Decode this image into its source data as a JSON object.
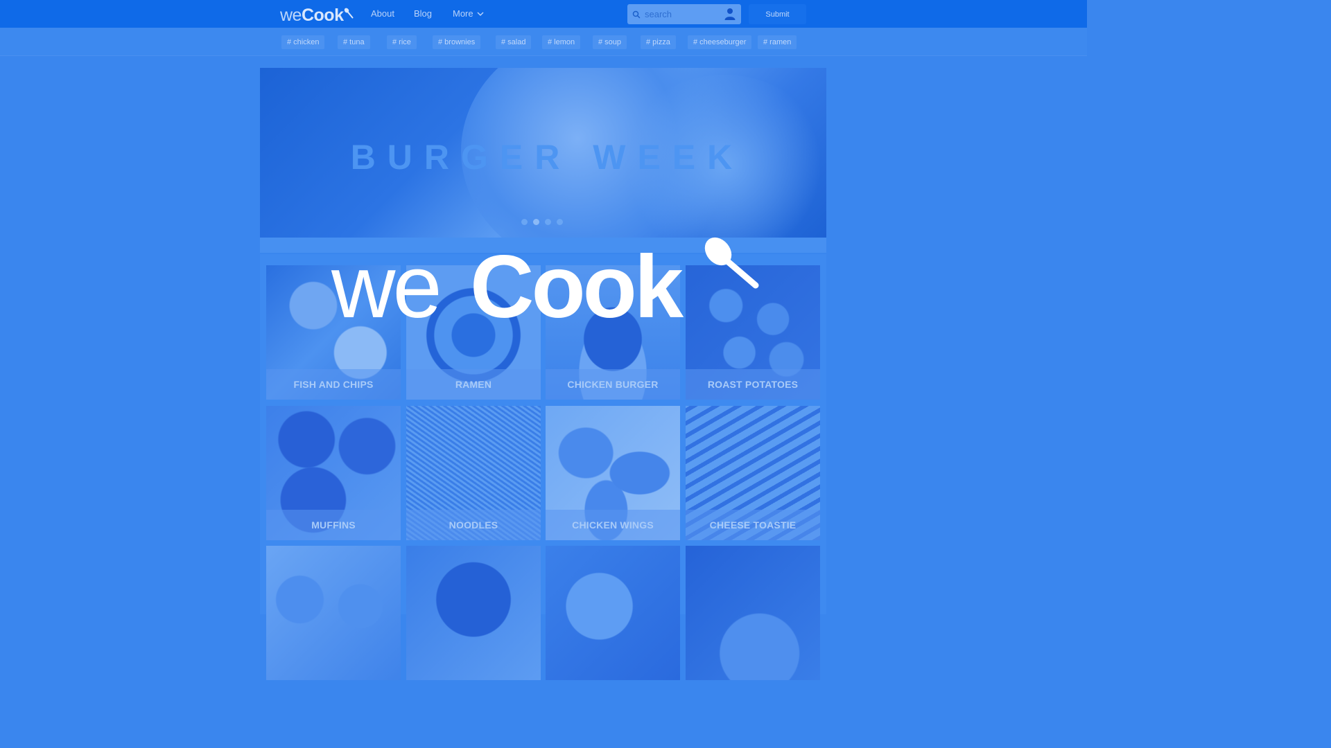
{
  "header": {
    "logo": {
      "we": "we",
      "cook": "Cook"
    },
    "nav": [
      {
        "label": "About"
      },
      {
        "label": "Blog"
      },
      {
        "label": "More"
      }
    ],
    "search": {
      "placeholder": "search",
      "value": ""
    },
    "submit_label": "Submit"
  },
  "tags": [
    "# chicken",
    "# tuna",
    "# rice",
    "# brownies",
    "# salad",
    "# lemon",
    "# soup",
    "# pizza",
    "# cheeseburger",
    "# ramen"
  ],
  "banner": {
    "title": "BURGER WEEK",
    "slide_count": 4,
    "active_slide": 2
  },
  "recipes": [
    {
      "title": "FISH AND CHIPS"
    },
    {
      "title": "RAMEN"
    },
    {
      "title": "CHICKEN BURGER"
    },
    {
      "title": "ROAST POTATOES"
    },
    {
      "title": "MUFFINS"
    },
    {
      "title": "NOODLES"
    },
    {
      "title": "CHICKEN WINGS"
    },
    {
      "title": "CHEESE TOASTIE"
    },
    {
      "title": ""
    },
    {
      "title": ""
    },
    {
      "title": ""
    },
    {
      "title": ""
    }
  ],
  "overlay_logo": {
    "we": "we",
    "cook": "Cook"
  },
  "colors": {
    "nav_bar": "#0f6ae8",
    "page_background": "#3a86ee",
    "logo_white": "#ffffff"
  },
  "icons": [
    "spoon-icon",
    "search-icon",
    "user-icon",
    "chevron-down-icon"
  ]
}
